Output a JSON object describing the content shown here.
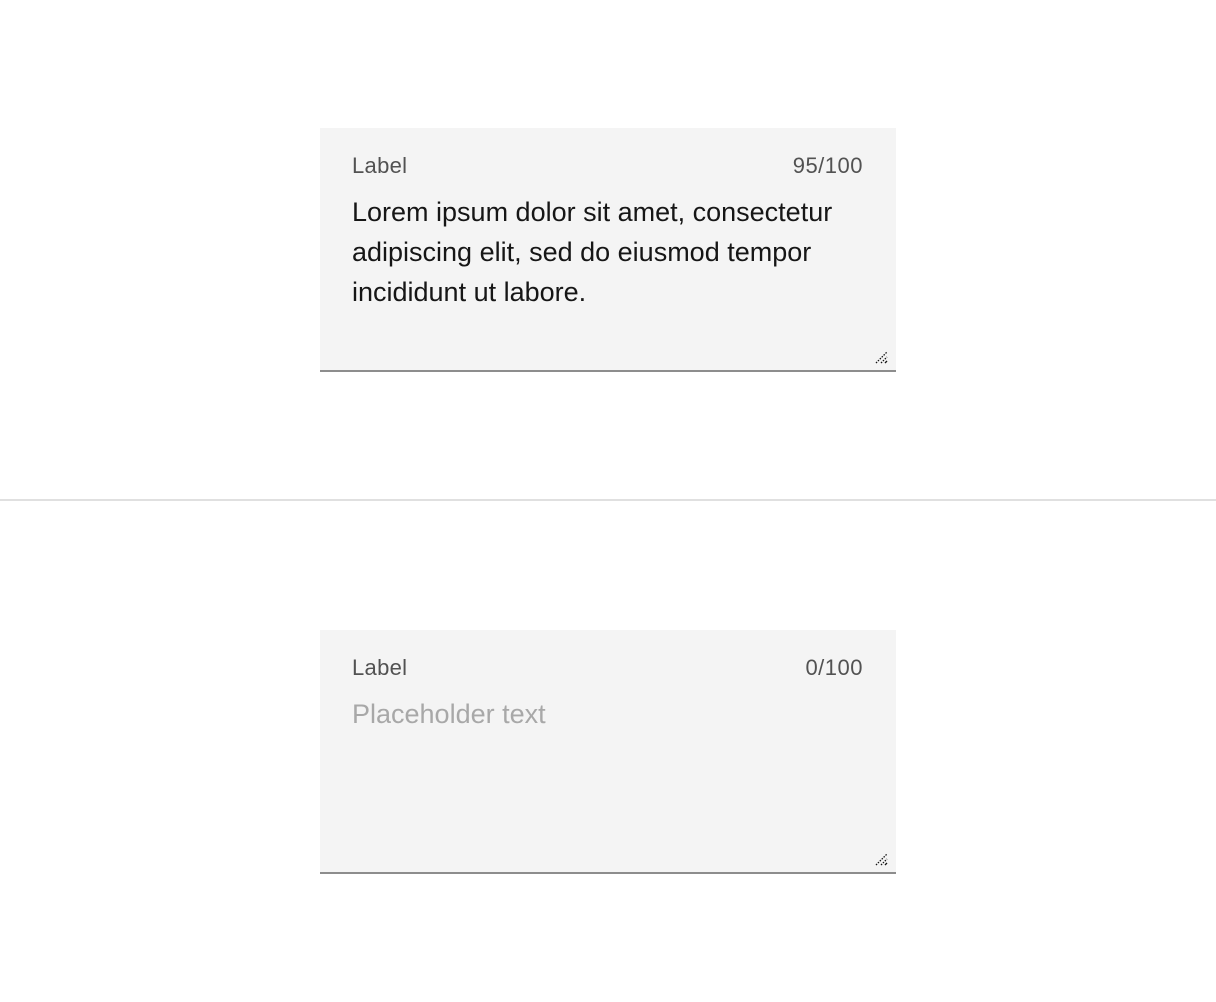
{
  "fields": [
    {
      "label": "Label",
      "counter": "95/100",
      "value": "Lorem ipsum dolor sit amet, consectetur adipiscing elit, sed do eiusmod tempor incididunt ut labore.",
      "placeholder": ""
    },
    {
      "label": "Label",
      "counter": "0/100",
      "value": "",
      "placeholder": "Placeholder text"
    }
  ],
  "icons": {
    "resize": "resize-grip-icon"
  },
  "colors": {
    "field_background": "#f4f4f4",
    "field_border": "#8d8d8d",
    "label": "#525252",
    "text": "#161616",
    "placeholder": "#a8a8a8",
    "divider": "#e0e0e0"
  }
}
